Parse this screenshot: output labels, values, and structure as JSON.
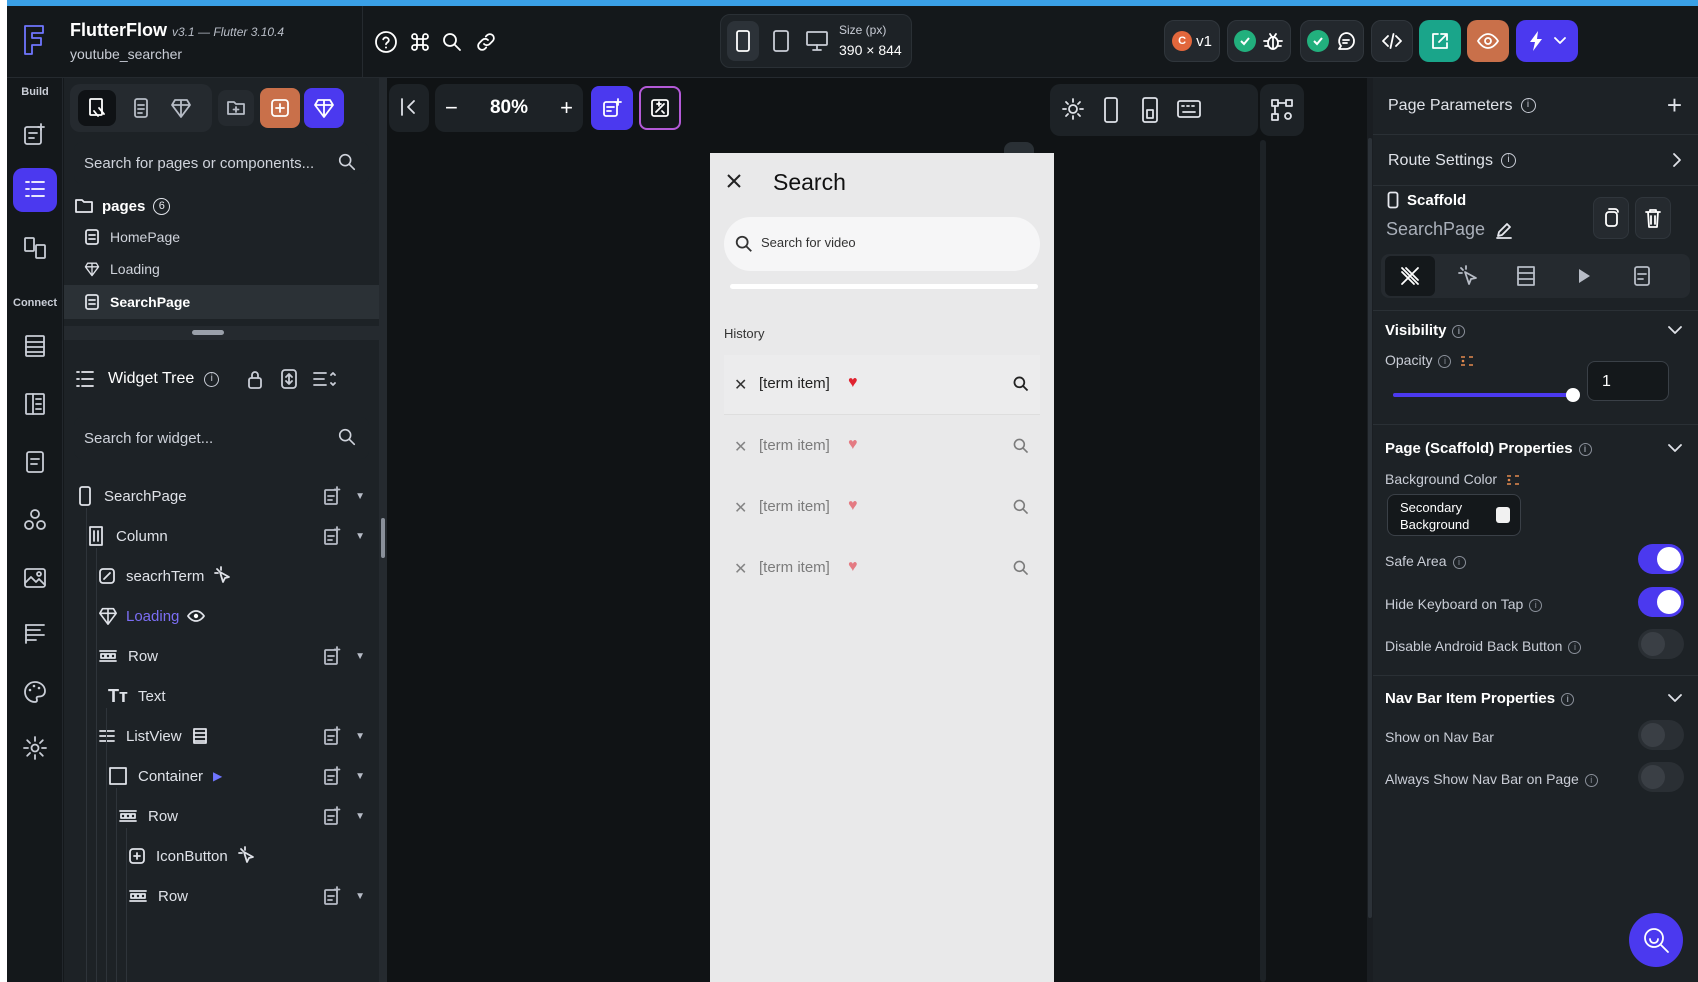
{
  "app": {
    "name": "FlutterFlow",
    "version": "v3.1 — Flutter 3.10.4",
    "project": "youtube_searcher"
  },
  "topbar": {
    "size_label": "Size (px)",
    "size_value": "390 × 844",
    "version_badge": "v1"
  },
  "rail": {
    "build_label": "Build",
    "connect_label": "Connect"
  },
  "left_panel": {
    "search_pages_placeholder": "Search for pages or components...",
    "pages_label": "pages",
    "pages_count": "6",
    "pages": [
      "HomePage",
      "Loading",
      "SearchPage"
    ],
    "widget_tree_title": "Widget Tree",
    "search_widget_placeholder": "Search for widget...",
    "tree": [
      {
        "label": "SearchPage"
      },
      {
        "label": "Column"
      },
      {
        "label": "seacrhTerm"
      },
      {
        "label": "Loading"
      },
      {
        "label": "Row"
      },
      {
        "label": "Text"
      },
      {
        "label": "ListView"
      },
      {
        "label": "Container"
      },
      {
        "label": "Row"
      },
      {
        "label": "IconButton"
      },
      {
        "label": "Row"
      }
    ]
  },
  "canvas": {
    "zoom": "80%",
    "phone": {
      "title": "Search",
      "search_placeholder": "Search for video",
      "history_label": "History",
      "items": [
        "[term item]",
        "[term item]",
        "[term item]",
        "[term item]"
      ]
    }
  },
  "right_panel": {
    "page_parameters": "Page Parameters",
    "route_settings": "Route Settings",
    "scaffold_label": "Scaffold",
    "page_name": "SearchPage",
    "visibility_title": "Visibility",
    "opacity_label": "Opacity",
    "opacity_value": "1",
    "opacity_fraction": 1.0,
    "scaffold_props_title": "Page (Scaffold) Properties",
    "bg_color_label": "Background Color",
    "bg_color_value_line1": "Secondary",
    "bg_color_value_line2": "Background",
    "safe_area_label": "Safe Area",
    "hide_keyboard_label": "Hide Keyboard on Tap",
    "disable_back_label": "Disable Android Back Button",
    "nav_bar_title": "Nav Bar Item Properties",
    "show_nav_label": "Show on Nav Bar",
    "always_show_nav_label": "Always Show Nav Bar on Page"
  },
  "colors": {
    "accent": "#4b39ef",
    "teal": "#1aa58a",
    "orange": "#c9704a",
    "heart": "#e0222f",
    "background": "#14181b",
    "panel": "#1d2226"
  }
}
